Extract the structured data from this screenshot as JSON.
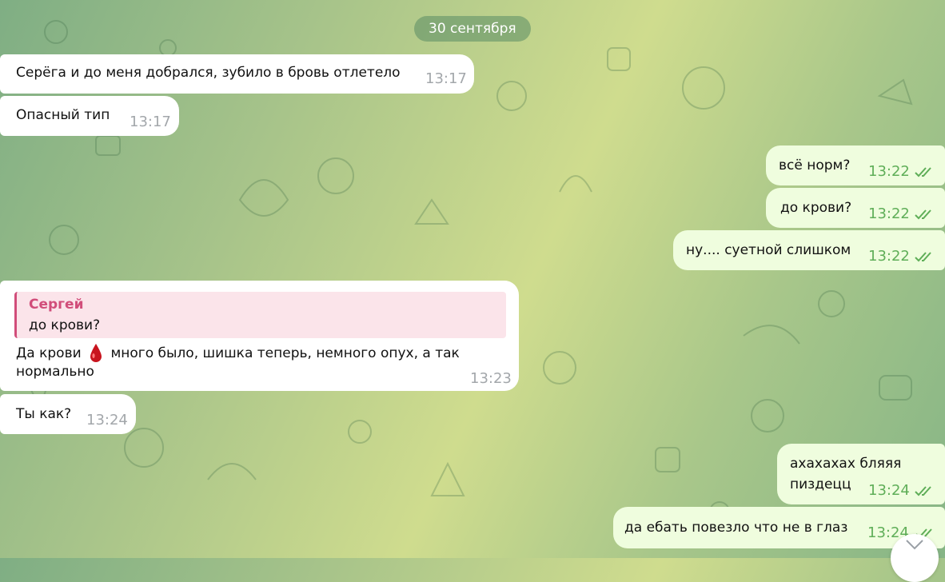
{
  "date_separator": "30 сентября",
  "messages": [
    {
      "text": "Серёга и до меня добрался, зубило в бровь отлетело",
      "time": "13:17"
    },
    {
      "text": "Опасный тип",
      "time": "13:17"
    },
    {
      "text": "всё норм?",
      "time": "13:22"
    },
    {
      "text": "до крови?",
      "time": "13:22"
    },
    {
      "text": "ну.... суетной слишком",
      "time": "13:22"
    },
    {
      "reply": {
        "name": "Сергей",
        "text": "до крови?"
      },
      "line1_before": "Да крови",
      "emoji": "drop-of-blood-icon",
      "line1_after": "много было, шишка теперь, немного опух, а так",
      "line2": "нормально",
      "time": "13:23"
    },
    {
      "text": "Ты как?",
      "time": "13:24"
    },
    {
      "line1": "ахахахах бляяя",
      "line2": "пиздецц",
      "time": "13:24"
    },
    {
      "text": "да ебать повезло что не в глаз",
      "time": "13:24"
    }
  ],
  "colors": {
    "incoming_bg": "#ffffff",
    "outgoing_bg": "#effdde",
    "time_out": "#5fae58",
    "reply_accent": "#d14d7a"
  }
}
